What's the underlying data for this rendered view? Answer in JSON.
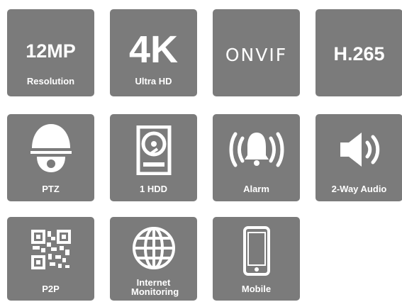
{
  "tiles": {
    "resolution": {
      "title": "12MP",
      "label": "Resolution"
    },
    "ultra_hd": {
      "title": "4K",
      "label": "Ultra HD"
    },
    "onvif": {
      "title": "ONVIF"
    },
    "codec": {
      "title": "H.265"
    },
    "ptz": {
      "label": "PTZ",
      "icon": "ptz-dome-camera-icon"
    },
    "hdd": {
      "label": "1 HDD",
      "icon": "hard-drive-icon"
    },
    "alarm": {
      "label": "Alarm",
      "icon": "alarm-bell-icon"
    },
    "audio": {
      "label": "2-Way Audio",
      "icon": "speaker-icon"
    },
    "p2p": {
      "label": "P2P",
      "icon": "qr-code-icon"
    },
    "internet": {
      "label": "Internet Monitoring",
      "icon": "globe-icon"
    },
    "mobile": {
      "label": "Mobile",
      "icon": "smartphone-icon"
    }
  },
  "colors": {
    "tile": "#7b7b7b",
    "text": "#ffffff",
    "background": "#ffffff"
  }
}
